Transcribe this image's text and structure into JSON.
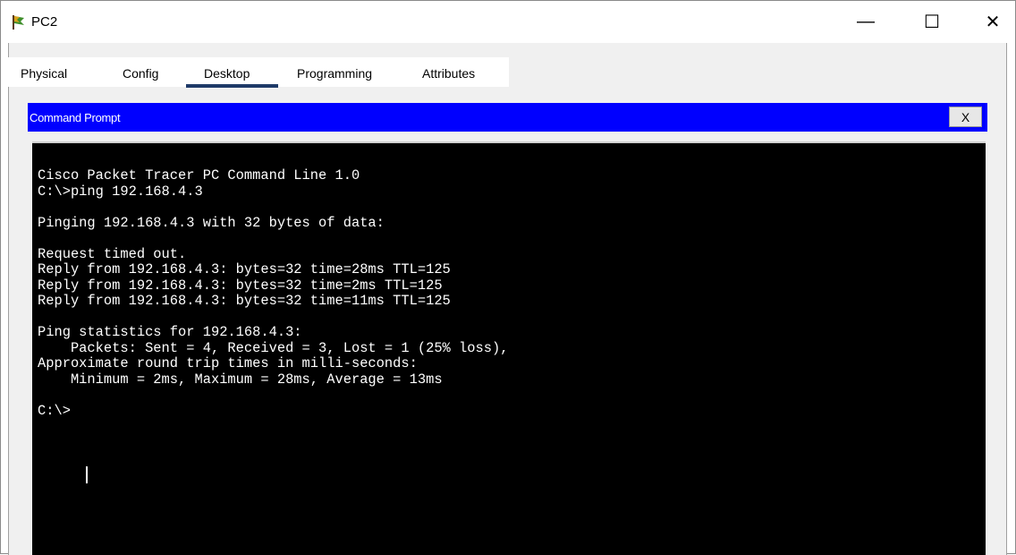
{
  "window": {
    "title": "PC2",
    "icon": "packet-tracer-pc-icon",
    "minimize_glyph": "—",
    "maximize_glyph": "☐",
    "close_glyph": "✕"
  },
  "tabs": [
    {
      "label": "Physical"
    },
    {
      "label": "Config"
    },
    {
      "label": "Desktop",
      "active": true
    },
    {
      "label": "Programming"
    },
    {
      "label": "Attributes"
    }
  ],
  "command_prompt": {
    "title": "Command Prompt",
    "close_label": "X",
    "header_color": "#0000ff"
  },
  "terminal": {
    "lines": [
      "Cisco Packet Tracer PC Command Line 1.0",
      "C:\\>ping 192.168.4.3",
      "",
      "Pinging 192.168.4.3 with 32 bytes of data:",
      "",
      "Request timed out.",
      "Reply from 192.168.4.3: bytes=32 time=28ms TTL=125",
      "Reply from 192.168.4.3: bytes=32 time=2ms TTL=125",
      "Reply from 192.168.4.3: bytes=32 time=11ms TTL=125",
      "",
      "Ping statistics for 192.168.4.3:",
      "    Packets: Sent = 4, Received = 3, Lost = 1 (25% loss),",
      "Approximate round trip times in milli-seconds:",
      "    Minimum = 2ms, Maximum = 28ms, Average = 13ms",
      "",
      "C:\\>"
    ]
  }
}
